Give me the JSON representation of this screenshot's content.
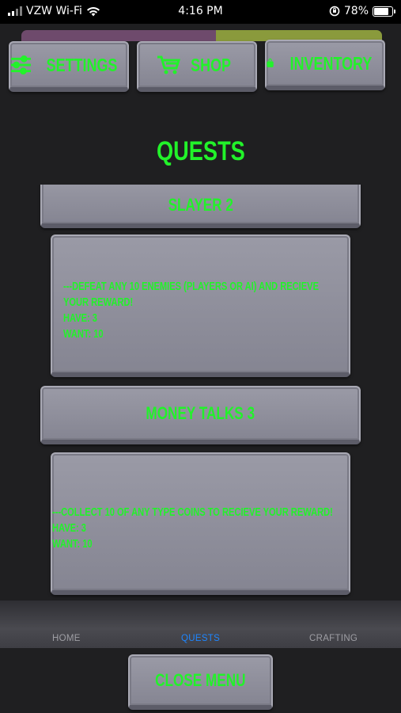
{
  "status_bar": {
    "carrier": "VZW Wi-Fi",
    "time": "4:16 PM",
    "battery": "78%"
  },
  "progress": {
    "filled_fraction": 0.54,
    "color_a": "#6e4a6c",
    "color_b": "#8a9a3c"
  },
  "top_buttons": {
    "settings": "SETTINGS",
    "shop": "SHOP",
    "inventory": "INVENTORY"
  },
  "page_title": "QUESTS",
  "quests": [
    {
      "title": "SLAYER 2",
      "description": "---DEFEAT ANY 10 ENEMIES (PLAYERS OR AI) AND RECIEVE",
      "description_line2": "YOUR REWARD!",
      "have": "HAVE: 3",
      "want": "WANT: 10"
    },
    {
      "title": "MONEY TALKS 3",
      "description": "---COLLECT 10 OF ANY TYPE COINS TO RECIEVE YOUR REWARD!",
      "have": "HAVE: 3",
      "want": "WANT: 10"
    }
  ],
  "tabs": {
    "home": "HOME",
    "quests": "QUESTS",
    "crafting": "CRAFTING",
    "active": "quests"
  },
  "close_menu": "CLOSE MENU",
  "colors": {
    "accent_green": "#22f22a",
    "active_tab_blue": "#1e86ff",
    "stone": "#8d8d99",
    "background": "#1f1f21"
  }
}
